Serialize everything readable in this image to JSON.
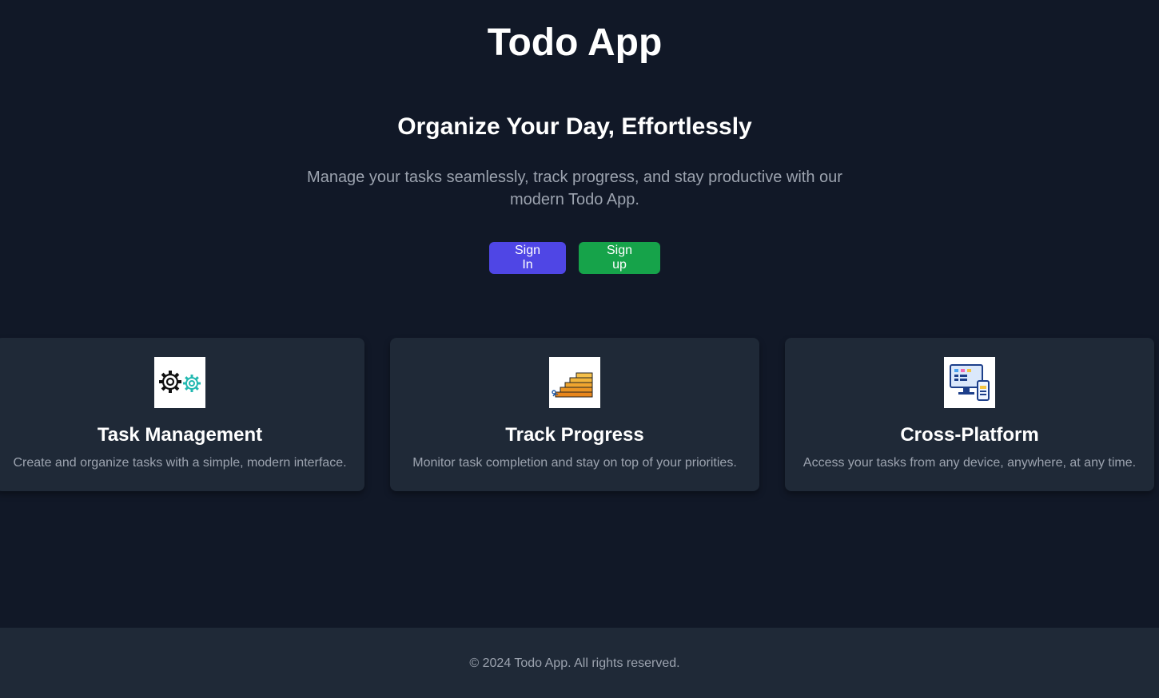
{
  "header": {
    "title": "Todo App"
  },
  "hero": {
    "heading": "Organize Your Day, Effortlessly",
    "text": "Manage your tasks seamlessly, track progress, and stay productive with our modern Todo App.",
    "signin_label": "Sign In",
    "signup_label": "Sign up"
  },
  "features": [
    {
      "icon": "gears-icon",
      "title": "Task Management",
      "description": "Create and organize tasks with a simple, modern interface."
    },
    {
      "icon": "stairs-progress-icon",
      "title": "Track Progress",
      "description": "Monitor task completion and stay on top of your priorities."
    },
    {
      "icon": "devices-icon",
      "title": "Cross-Platform",
      "description": "Access your tasks from any device, anywhere, at any time."
    }
  ],
  "footer": {
    "text": "© 2024 Todo App. All rights reserved."
  },
  "colors": {
    "background": "#111827",
    "card": "#1f2937",
    "signin": "#4f46e5",
    "signup": "#16a34a",
    "muted_text": "#9ca3af"
  }
}
